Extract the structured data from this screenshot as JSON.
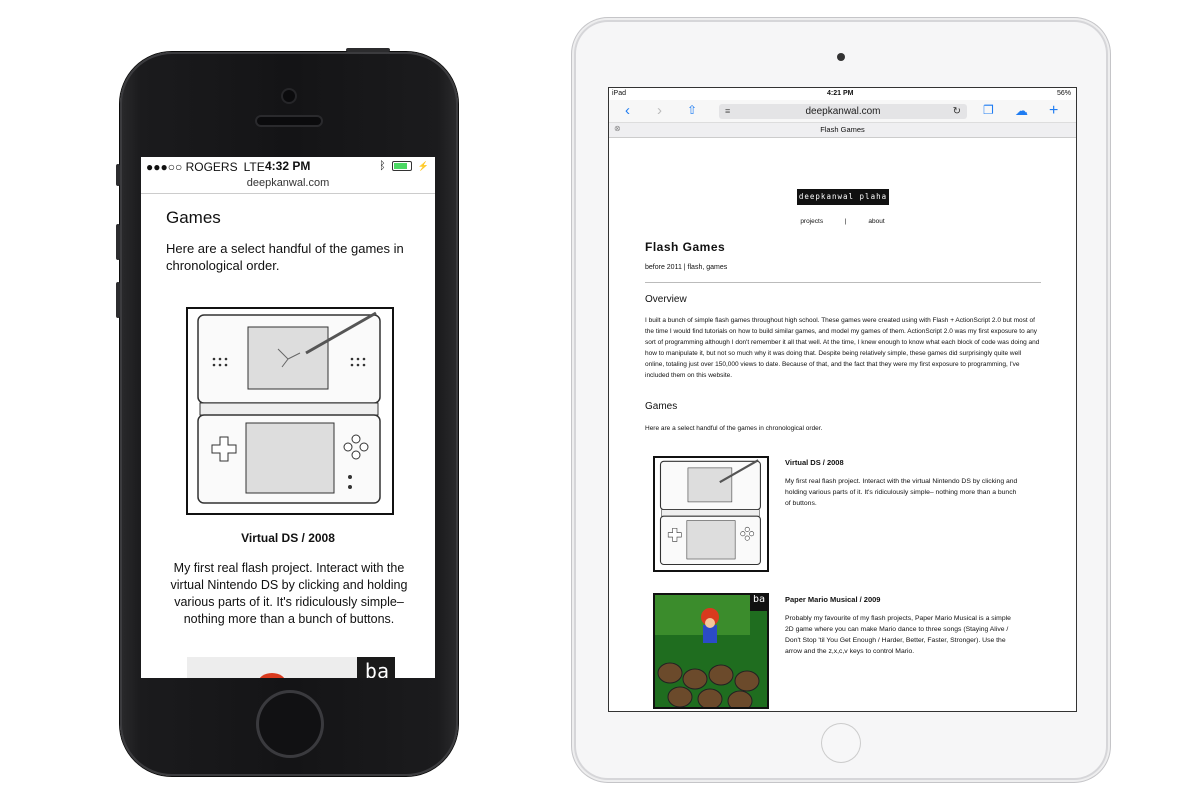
{
  "phone": {
    "status": {
      "carrier": "●●●○○ ROGERS",
      "network": "LTE",
      "time": "4:32 PM"
    },
    "url": "deepkanwal.com",
    "heading": "Games",
    "intro": "Here are a select handful of the games in chronological order.",
    "game1": {
      "caption": "Virtual DS  /  2008",
      "description": "My first real flash project. Interact with the virtual Nintendo DS by clicking and holding various parts of it. It's ridiculously simple– nothing more than a bunch of buttons."
    },
    "game2_badge": "ba"
  },
  "ipad": {
    "status": {
      "device": "iPad",
      "time": "4:21 PM",
      "battery": "56%"
    },
    "url": "deepkanwal.com",
    "tab_title": "Flash Games",
    "logo": "deepkanwal plaha",
    "nav": {
      "projects": "projects",
      "separator": "|",
      "about": "about"
    },
    "page_title": "Flash Games",
    "meta": "before  2011    |  flash, games",
    "overview_heading": "Overview",
    "overview_text": "I built a bunch of simple flash games throughout high school. These games were created using with Flash + ActionScript 2.0 but most of the time I would find tutorials on how to build similar games, and model my games of them. ActionScript 2.0 was my first exposure to any sort of programming although I don't remember it all that well. At the time, I knew enough to know what each block of code was doing and how to manipulate it, but not so much why it was doing that. Despite being relatively simple, these games did surprisingly quite well online, totaling just over 150,000 views to date. Because of that, and the fact that they were my first exposure to programming, I've included them on this website.",
    "games_heading": "Games",
    "games_intro": "Here are a select handful of the games in chronological order.",
    "games": [
      {
        "title": "Virtual DS  /  2008",
        "description": "My first real flash project. Interact with the virtual Nintendo DS by clicking and holding various parts of it. It's ridiculously simple– nothing more than a bunch of buttons."
      },
      {
        "title": "Paper Mario Musical  /  2009",
        "description": "Probably my favourite of my flash projects, Paper Mario Musical is a simple 2D game where you can make Mario dance to three songs (Staying Alive / Don't Stop 'til You Get Enough / Harder, Better, Faster, Stronger). Use the arrow and the z,x,c,v keys to control Mario.",
        "badge": "ba"
      }
    ]
  },
  "colors": {
    "accent": "#1e7cf2",
    "battery": "#4cd964",
    "device_dark": "#141416",
    "logo_bg": "#111111"
  }
}
